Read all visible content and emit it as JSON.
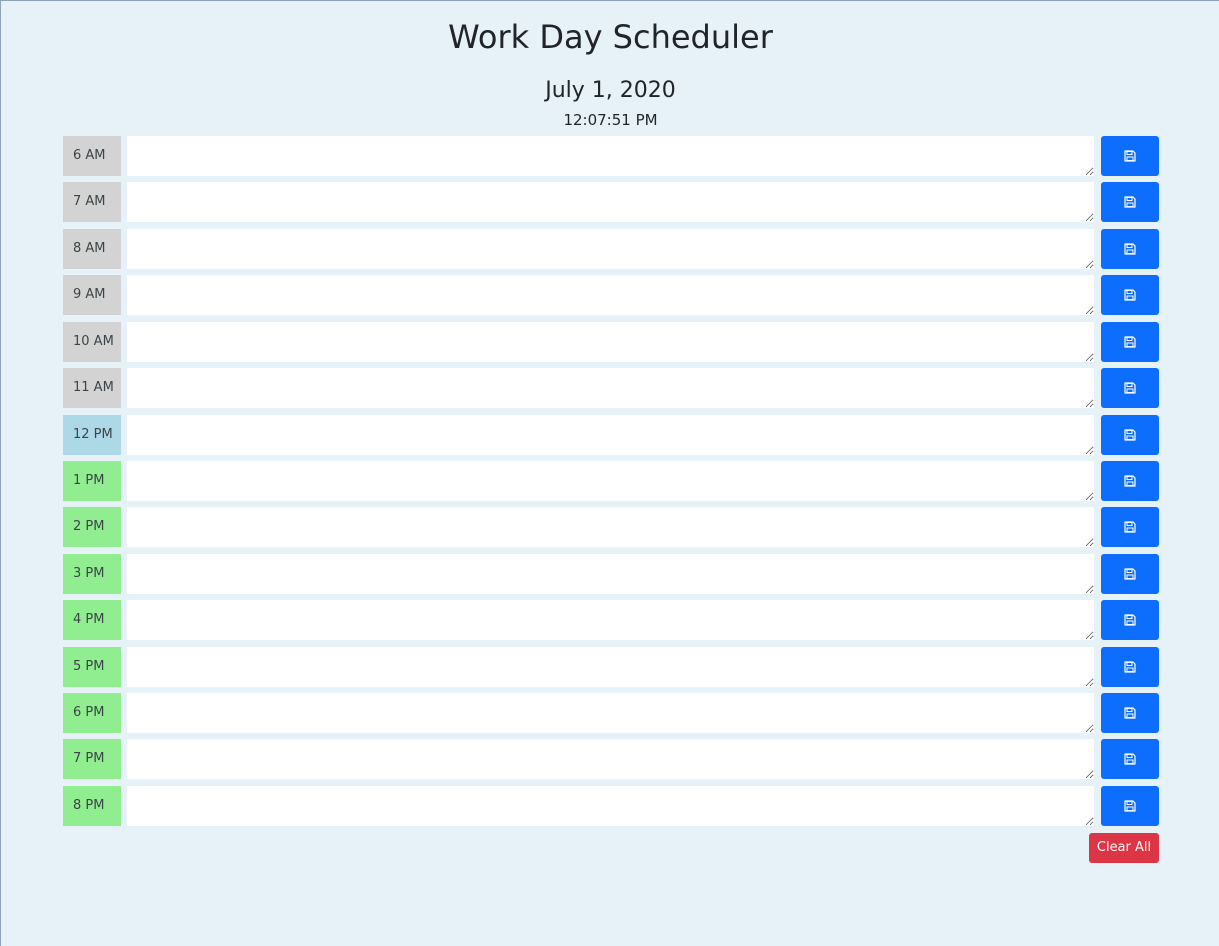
{
  "header": {
    "title": "Work Day Scheduler",
    "date": "July 1, 2020",
    "time": "12:07:51 PM"
  },
  "icons": {
    "save": "floppy-disk-icon"
  },
  "colors": {
    "background": "#e7f2f8",
    "past": "#d3d3d3",
    "present": "#add8e6",
    "future": "#90ee90",
    "save_button": "#0d6efd",
    "clear_button": "#dc3545"
  },
  "hours": [
    {
      "label": "6 AM",
      "state": "past",
      "entry": ""
    },
    {
      "label": "7 AM",
      "state": "past",
      "entry": ""
    },
    {
      "label": "8 AM",
      "state": "past",
      "entry": ""
    },
    {
      "label": "9 AM",
      "state": "past",
      "entry": ""
    },
    {
      "label": "10 AM",
      "state": "past",
      "entry": ""
    },
    {
      "label": "11 AM",
      "state": "past",
      "entry": ""
    },
    {
      "label": "12 PM",
      "state": "present",
      "entry": ""
    },
    {
      "label": "1 PM",
      "state": "future",
      "entry": ""
    },
    {
      "label": "2 PM",
      "state": "future",
      "entry": ""
    },
    {
      "label": "3 PM",
      "state": "future",
      "entry": ""
    },
    {
      "label": "4 PM",
      "state": "future",
      "entry": ""
    },
    {
      "label": "5 PM",
      "state": "future",
      "entry": ""
    },
    {
      "label": "6 PM",
      "state": "future",
      "entry": ""
    },
    {
      "label": "7 PM",
      "state": "future",
      "entry": ""
    },
    {
      "label": "8 PM",
      "state": "future",
      "entry": ""
    }
  ],
  "clear_label": "Clear All"
}
